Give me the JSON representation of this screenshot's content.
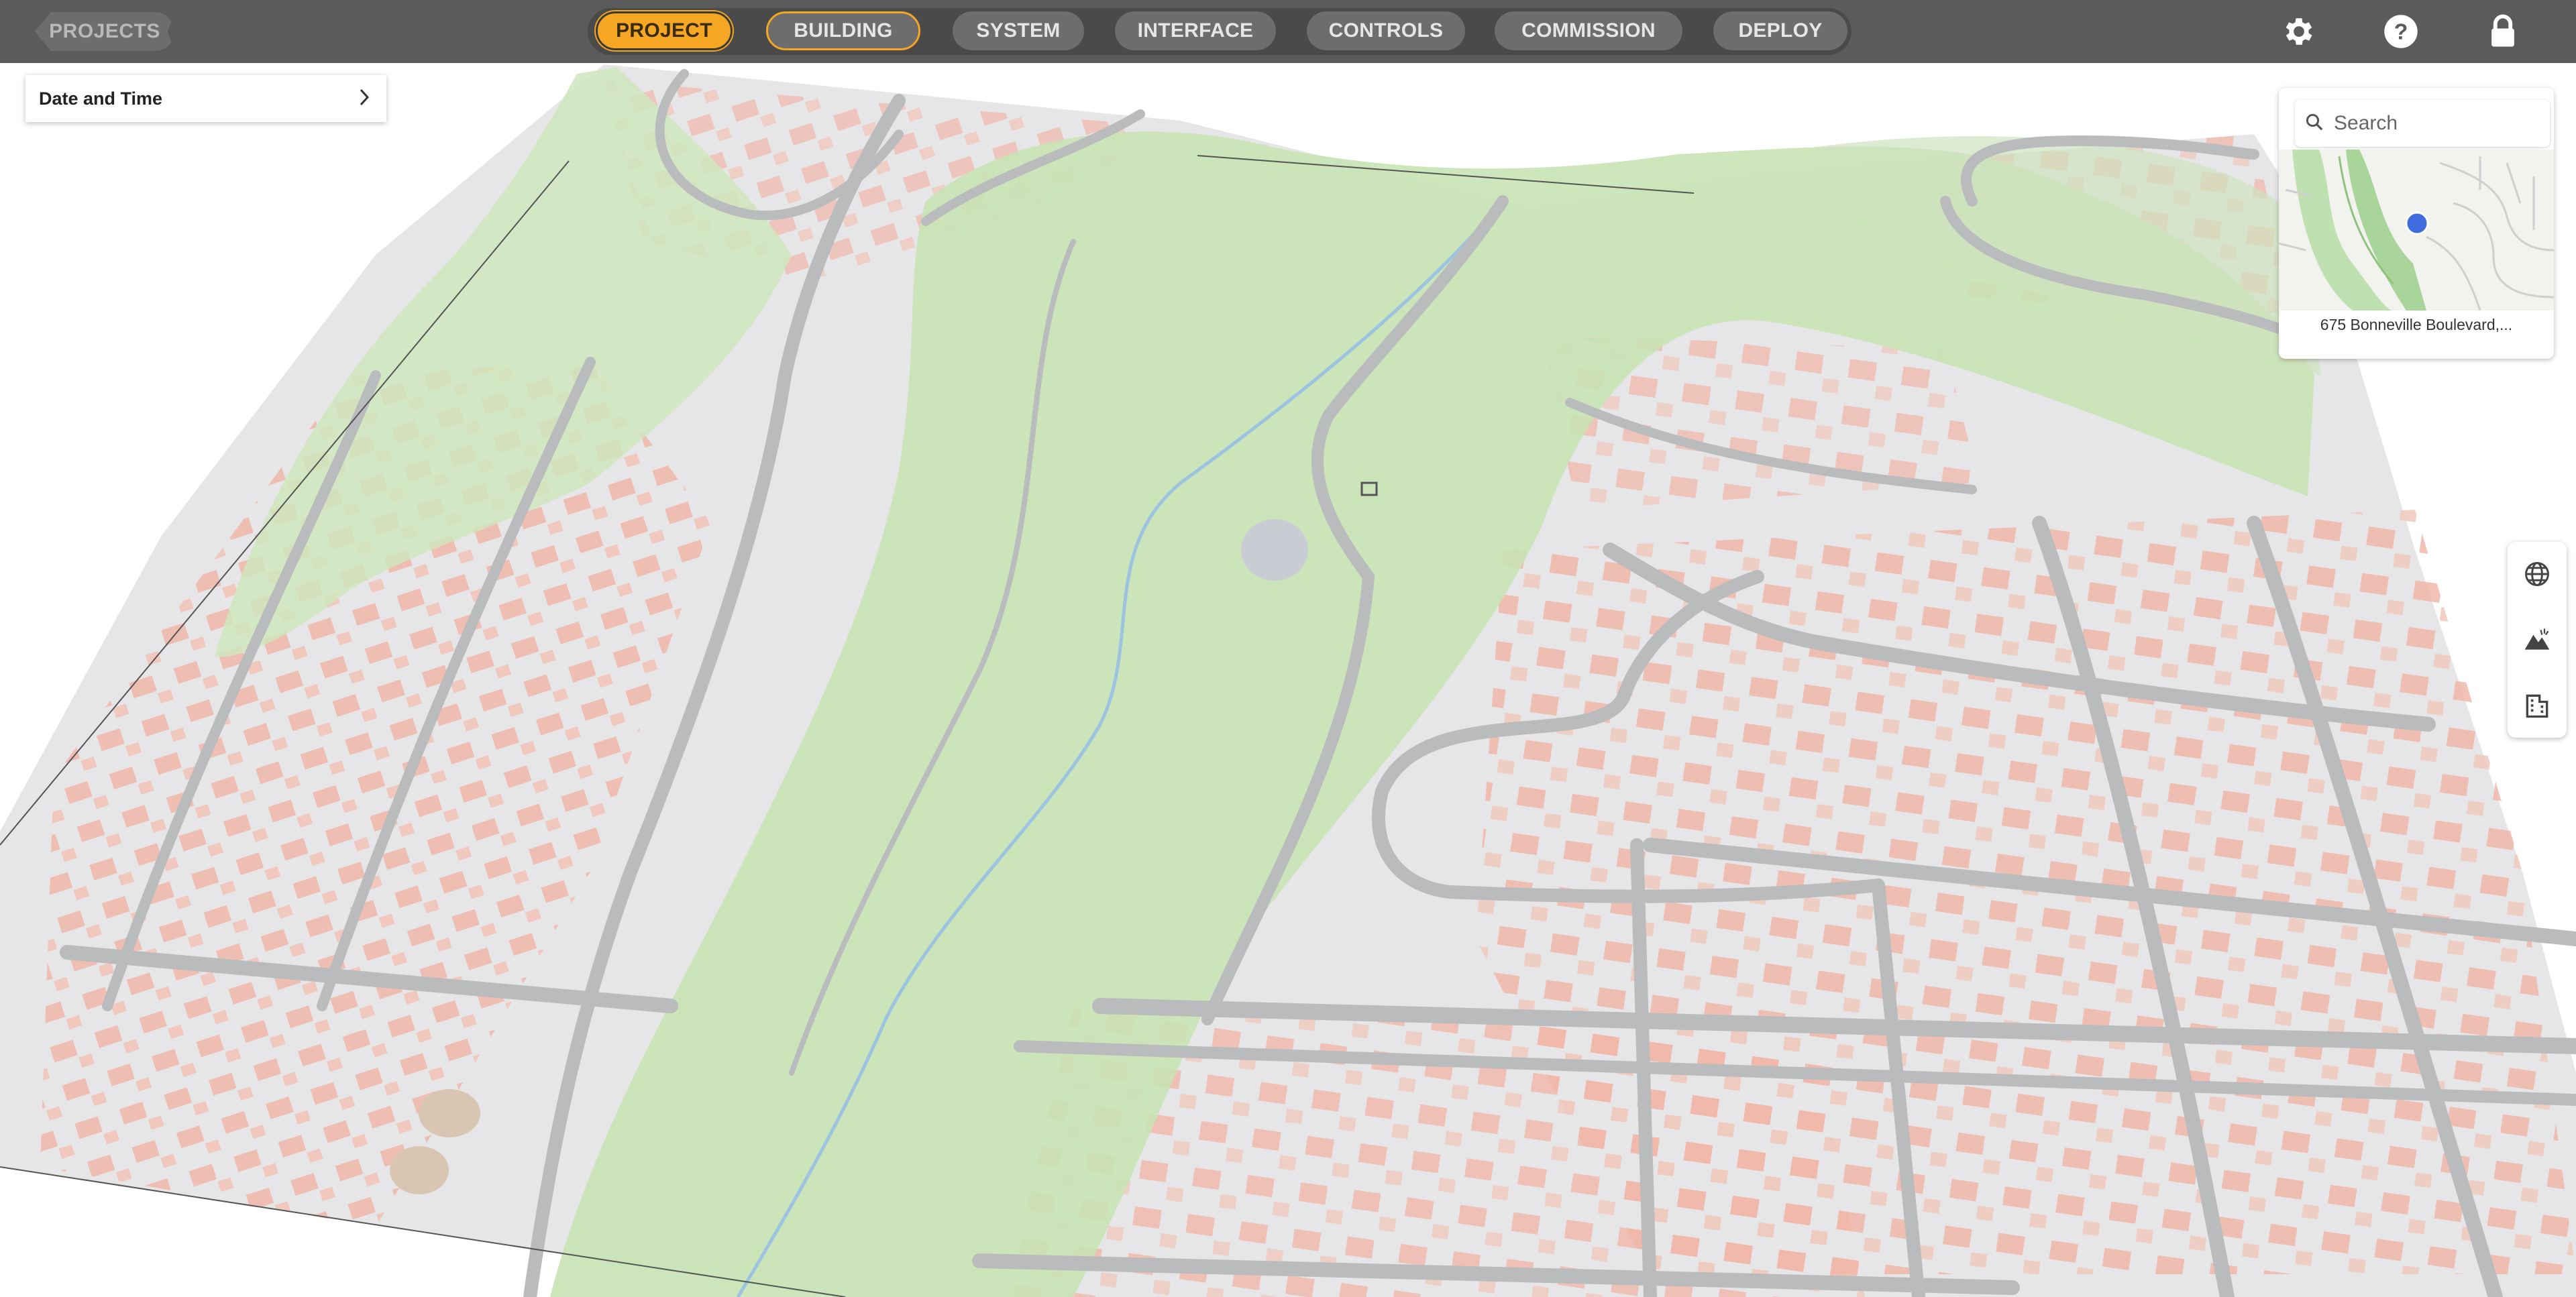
{
  "topbar": {
    "projects_label": "PROJECTS",
    "steps": [
      {
        "label": "PROJECT",
        "state": "active"
      },
      {
        "label": "BUILDING",
        "state": "in-progress"
      },
      {
        "label": "SYSTEM",
        "state": "inactive"
      },
      {
        "label": "INTERFACE",
        "state": "inactive"
      },
      {
        "label": "CONTROLS",
        "state": "inactive"
      },
      {
        "label": "COMMISSION",
        "state": "inactive"
      },
      {
        "label": "DEPLOY",
        "state": "inactive"
      }
    ],
    "icons": [
      "gear-icon",
      "help-icon",
      "lock-icon"
    ]
  },
  "date_panel": {
    "label": "Date and Time",
    "icon": "chevron-right-icon"
  },
  "minimap": {
    "search_placeholder": "Search",
    "address": "675 Bonneville Boulevard,..."
  },
  "tools": [
    "globe-icon",
    "terrain-icon",
    "building-icon"
  ],
  "colors": {
    "topbar": "#5b5b5b",
    "accent": "#f5a623",
    "terrain_green": "#c8e3b4",
    "road": "#b9bbbd",
    "building": "#f1b7aa",
    "ground": "#e6e6e8",
    "minimap_marker": "#3f6de0"
  }
}
